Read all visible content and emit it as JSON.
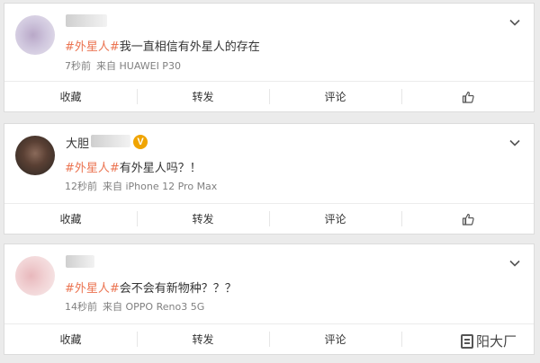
{
  "posts": [
    {
      "username": "",
      "verified": false,
      "text_tag": "#外星人#",
      "text_body": "我一直相信有外星人的存在",
      "time": "7秒前",
      "source": "来自 HUAWEI P30"
    },
    {
      "username": "大胆",
      "verified": true,
      "text_tag": "#外星人#",
      "text_body": "有外星人吗？！",
      "time": "12秒前",
      "source": "来自 iPhone 12 Pro Max"
    },
    {
      "username": "",
      "verified": false,
      "text_tag": "#外星人#",
      "text_body": "会不会有新物种？？？",
      "time": "14秒前",
      "source": "来自 OPPO Reno3 5G"
    }
  ],
  "actions": {
    "favorite": "收藏",
    "repost": "转发",
    "comment": "评论"
  },
  "icons": {
    "like": "thumbs-up-icon",
    "menu": "chevron-down-icon",
    "verified": "verified-v-badge"
  },
  "colors": {
    "hashtag": "#eb7350",
    "verified": "#f0a400"
  },
  "watermark": "阳大厂"
}
